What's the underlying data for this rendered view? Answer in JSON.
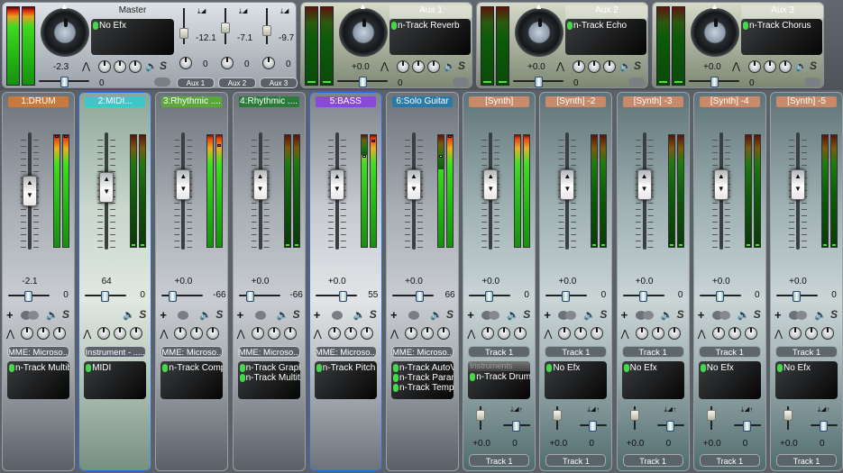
{
  "master": {
    "title": "Master",
    "volume": "-2.3",
    "pan": "0",
    "fx": [
      "No Efx"
    ],
    "aux_sends": [
      {
        "value": "-12.1",
        "pan": "0",
        "button": "Aux 1"
      },
      {
        "value": "-7.1",
        "pan": "0",
        "button": "Aux 2"
      },
      {
        "value": "-9.7",
        "pan": "0",
        "button": "Aux 3"
      }
    ]
  },
  "aux_channels": [
    {
      "title": "Aux 1",
      "volume": "+0.0",
      "pan": "0",
      "fx": [
        "n-Track Reverb"
      ]
    },
    {
      "title": "Aux 2",
      "volume": "+0.0",
      "pan": "0",
      "fx": [
        "n-Track Echo"
      ]
    },
    {
      "title": "Aux 3",
      "volume": "+0.0",
      "pan": "0",
      "fx": [
        "n-Track Chorus"
      ]
    }
  ],
  "icons": {
    "plus": "+",
    "speaker": "🔈",
    "solo": "S",
    "eq": "⋀"
  },
  "strips": [
    {
      "name": "1:DRUM",
      "color": "#c87a3c",
      "volume": "-2.1",
      "pan": "0",
      "device": "MME: Microso...",
      "fx": [
        "n-Track Multiba"
      ],
      "type": "audio"
    },
    {
      "name": "2:MIDI...",
      "color": "#3cc8c8",
      "volume": "64",
      "pan": "0",
      "device": "Instrument - .....",
      "fx": [
        "MIDI"
      ],
      "type": "midi"
    },
    {
      "name": "3:Rhythmic ....",
      "color": "#5aa83a",
      "volume": "+0.0",
      "pan": "-66",
      "device": "MME: Microso...",
      "fx": [
        "n-Track Comp"
      ],
      "type": "audio"
    },
    {
      "name": "4:Rhythmic ....",
      "color": "#2a7a3a",
      "volume": "+0.0",
      "pan": "-66",
      "device": "MME: Microso...",
      "fx": [
        "n-Track Graphi",
        "n-Track Multita"
      ],
      "type": "audio"
    },
    {
      "name": "5:BASS",
      "color": "#8a4ad8",
      "volume": "+0.0",
      "pan": "55",
      "device": "MME: Microso...",
      "fx": [
        "n-Track Pitch S"
      ],
      "type": "bass"
    },
    {
      "name": "6:Solo Guitar",
      "color": "#2a7aa8",
      "volume": "+0.0",
      "pan": "66",
      "device": "MME: Microso...",
      "fx": [
        "n-Track AutoVi",
        "n-Track Param",
        "n-Track Tempo"
      ],
      "type": "audio"
    },
    {
      "name": "[Synth]",
      "color": "#c88a6a",
      "volume": "+0.0",
      "pan": "0",
      "device": "Track 1",
      "fx_header": "Instruments",
      "fx": [
        "n-Track Drums"
      ],
      "type": "synth",
      "send_volume": "+0.0",
      "send_pan": "0",
      "send_button": "Track 1"
    },
    {
      "name": "[Synth] -2",
      "color": "#c88a6a",
      "volume": "+0.0",
      "pan": "0",
      "device": "Track 1",
      "fx": [
        "No Efx"
      ],
      "type": "synth",
      "send_volume": "+0.0",
      "send_pan": "0",
      "send_button": "Track 1"
    },
    {
      "name": "[Synth] -3",
      "color": "#c88a6a",
      "volume": "+0.0",
      "pan": "0",
      "device": "Track 1",
      "fx": [
        "No Efx"
      ],
      "type": "synth",
      "send_volume": "+0.0",
      "send_pan": "0",
      "send_button": "Track 1"
    },
    {
      "name": "[Synth] -4",
      "color": "#c88a6a",
      "volume": "+0.0",
      "pan": "0",
      "device": "Track 1",
      "fx": [
        "No Efx"
      ],
      "type": "synth",
      "send_volume": "+0.0",
      "send_pan": "0",
      "send_button": "Track 1"
    },
    {
      "name": "[Synth] -5",
      "color": "#c88a6a",
      "volume": "+0.0",
      "pan": "0",
      "device": "Track 1",
      "fx": [
        "No Efx"
      ],
      "type": "synth",
      "send_volume": "+0.0",
      "send_pan": "0",
      "send_button": "Track 1"
    }
  ]
}
